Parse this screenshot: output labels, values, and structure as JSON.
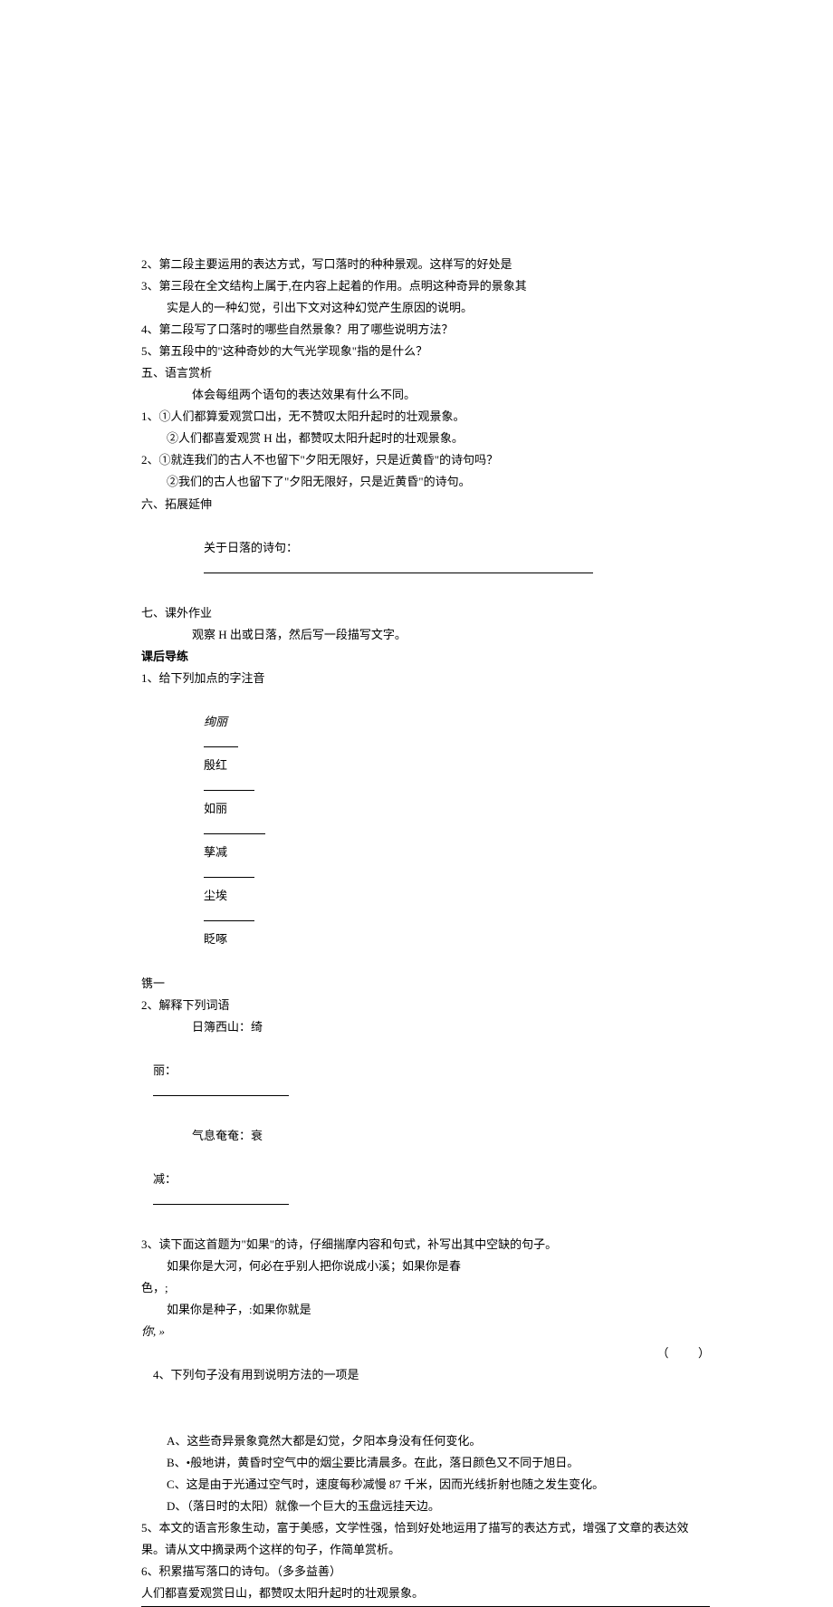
{
  "l2": "2、第二段主要运用的表达方式，写口落时的种种景观。这样写的好处是",
  "l3a": "3、第三段在全文结构上属于,在内容上起着的作用。点明这种奇异的景象其",
  "l3b": "实是人的一种幻觉，引出下文对这种幻觉产生原因的说明。",
  "l4": "4、第二段写了口落时的哪些自然景象？用了哪些说明方法？",
  "l5": "5、第五段中的\"这种奇妙的大气光学现象\"指的是什么？",
  "sec5": "五、语言赏析",
  "sec5t": "体会每组两个语句的表达效果有什么不同。",
  "s1a": "1、①人们都算爱观赏口出，无不赞叹太阳升起时的壮观景象。",
  "s1b": "②人们都喜爱观赏 H 出，都赞叹太阳升起时的壮观景象。",
  "s2a": "2、①就连我们的古人不也留下\"夕阳无限好，只是近黄昏\"的诗句吗？",
  "s2b": "②我们的古人也留下了\"夕阳无限好，只是近黄昏\"的诗句。",
  "sec6": "六、拓展延伸",
  "sec6t_a": "关于日落的诗句：",
  "sec7": "七、课外作业",
  "sec7t": "观察 H 出或日落，然后写一段描写文字。",
  "khdl": "课后导练",
  "q1": "1、给下列加点的字注音",
  "q1_a": "绚丽",
  "q1_b": "殷",
  "q1_b2": "红",
  "q1_c": "如丽",
  "q1_d": "孳减",
  "q1_e": "尘埃",
  "q1_f": "眨啄",
  "yinyi": "镌一",
  "q2": "2、解释下列词语",
  "q2a": "日簿西山：绮",
  "q2b_label": "丽：",
  "q2c": "气息奄奄：衰",
  "q2d_label": "减：",
  "q3a": "3、读下面这首题为\"如果\"的诗，仔细揣摩内容和句式，补写出其中空缺的句子。",
  "q3b": "如果你是大河，何必在乎别人把你说成小溪；如果你是春",
  "q3c": "色，;",
  "q3d": "如果你是种子，:如果你就是",
  "q3e": "你, »",
  "q4": "4、下列句子没有用到说明方法的一项是",
  "q4paren": "（          ）",
  "q4a": "A、这些奇异景象竟然大都是幻觉，夕阳本身没有任何变化。",
  "q4b": "B、•般地讲，黄昏时空气中的烟尘要比清晨多。在此，落日颜色又不同于旭日。",
  "q4c": "C、这是由于光通过空气时，速度每秒减慢 87 千米，因而光线折射也随之发生变化。",
  "q4d": "D、（落日时的太阳）就像一个巨大的玉盘远挂天边。",
  "q5a": "5、本文的语言形象生动，富于美感，文学性强，恰到好处地运用了描写的表达方式，增强了文章的表达效",
  "q5b": "果。请从文中摘录两个这样的句子，作简单赏析。",
  "q6": "6、积累描写落口的诗句。（多多益善）",
  "final": "人们都喜爱观赏日山，都赞叹太阳升起时的壮观景象。"
}
